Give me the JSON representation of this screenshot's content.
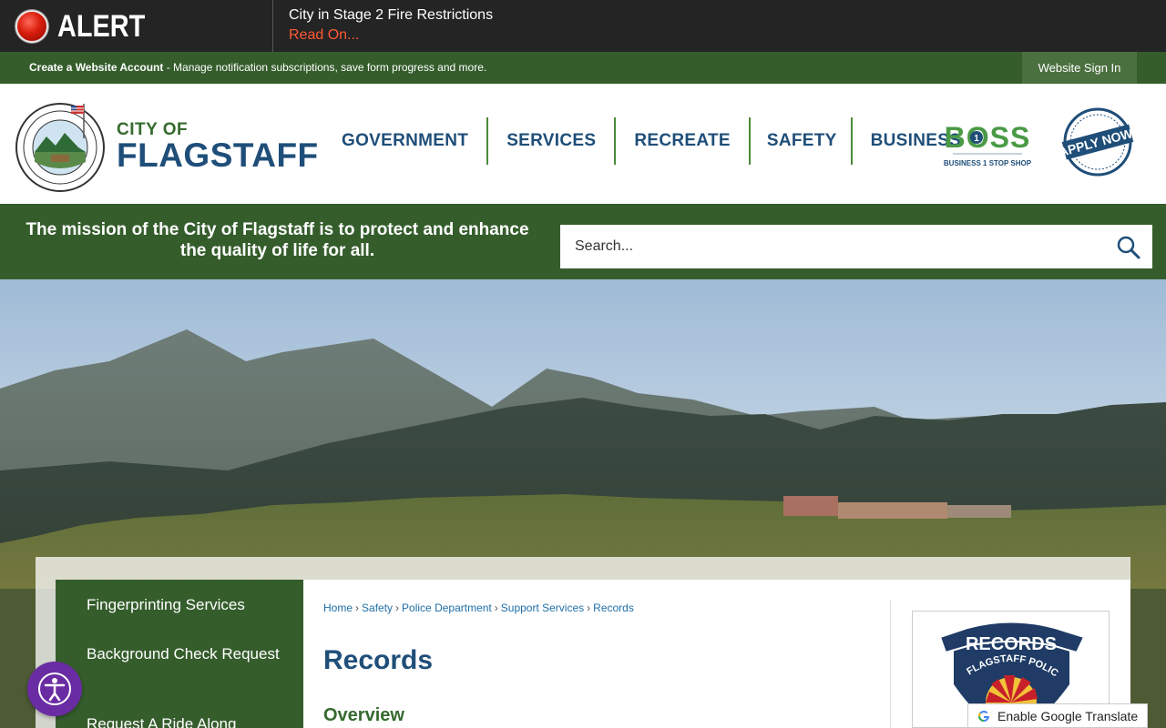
{
  "alert": {
    "label": "ALERT",
    "title": "City in Stage 2 Fire Restrictions",
    "link": "Read On..."
  },
  "account_bar": {
    "create_label": "Create a Website Account",
    "description": " - Manage notification subscriptions, save form progress and more.",
    "signin_label": "Website Sign In"
  },
  "header": {
    "city_of": "CITY OF",
    "city_name": "FLAGSTAFF",
    "nav": [
      "GOVERNMENT",
      "SERVICES",
      "RECREATE",
      "SAFETY",
      "BUSINESS"
    ],
    "boss_text": "BOSS",
    "boss_sub": "BUSINESS 1 STOP SHOP",
    "apply_text": "APPLY NOW!"
  },
  "mission": {
    "text": "The mission of the City of Flagstaff is to protect and enhance the quality of life for all."
  },
  "search": {
    "placeholder": "Search..."
  },
  "side_nav": {
    "items": [
      "Fingerprinting Services",
      "Background Check Request",
      "Request A Ride Along"
    ]
  },
  "breadcrumb": [
    "Home",
    "Safety",
    "Police Department",
    "Support Services",
    "Records"
  ],
  "page": {
    "title": "Records",
    "section": "Overview"
  },
  "records_card": {
    "banner": "RECORDS",
    "arc": "FLAGSTAFF POLICE DEPARTMENT"
  },
  "translate": {
    "label": "Enable Google Translate"
  },
  "colors": {
    "brand_green": "#355d2c",
    "brand_blue": "#1f4e79",
    "alert_red": "#ff5a36",
    "accessibility_purple": "#6a2ca3"
  }
}
